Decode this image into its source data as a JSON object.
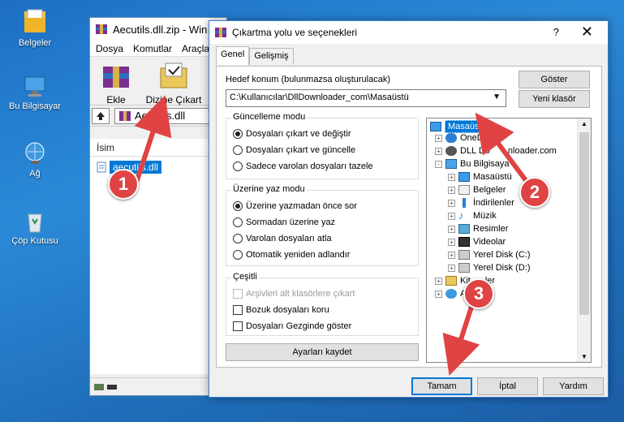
{
  "desktop": {
    "icons": [
      {
        "label": "Belgeler"
      },
      {
        "label": "Bu Bilgisayar"
      },
      {
        "label": "Ağ"
      },
      {
        "label": "Çöp Kutusu"
      }
    ]
  },
  "winrar": {
    "title": "Aecutils.dll.zip - Win",
    "menu": [
      "Dosya",
      "Komutlar",
      "Araçla"
    ],
    "tools": [
      {
        "label": "Ekle"
      },
      {
        "label": "Dizine Çıkart"
      }
    ],
    "address": "Aecutils.dll",
    "column_name": "İsim",
    "file": "aecutils.dll"
  },
  "dialog": {
    "title": "Çıkartma yolu ve seçenekleri",
    "help": "?",
    "close": "✕",
    "tabs": [
      "Genel",
      "Gelişmiş"
    ],
    "dest_label": "Hedef konum (bulunmazsa oluşturulacak)",
    "dest_value": "C:\\Kullanıcılar\\DllDownloader_com\\Masaüstü",
    "show_button": "Göster",
    "new_folder_button": "Yeni klasör",
    "update_group": {
      "title": "Güncelleme modu",
      "options": [
        "Dosyaları çıkart ve değiştir",
        "Dosyaları çıkart ve güncelle",
        "Sadece varolan dosyaları tazele"
      ],
      "selected": 0
    },
    "overwrite_group": {
      "title": "Üzerine yaz modu",
      "options": [
        "Üzerine yazmadan önce sor",
        "Sormadan üzerine yaz",
        "Varolan dosyaları atla",
        "Otomatik yeniden adlandır"
      ],
      "selected": 0
    },
    "misc_group": {
      "title": "Çeşitli",
      "options": [
        "Arşivleri alt klasörlere çıkart",
        "Bozuk dosyaları koru",
        "Dosyaları Gezginde göster"
      ]
    },
    "save_settings": "Ayarları kaydet",
    "tree": [
      "Masaüstü",
      "OneD",
      "DLL Do",
      "nloader.com",
      "Bu Bilgisaya",
      "Masaüstü",
      "Belgeler",
      "İndirilenler",
      "Müzik",
      "Resimler",
      "Videolar",
      "Yerel Disk (C:)",
      "Yerel Disk (D:)",
      "Kit",
      "ler",
      "A"
    ],
    "ok": "Tamam",
    "cancel": "İptal",
    "help_button": "Yardım"
  },
  "badges": [
    "1",
    "2",
    "3"
  ],
  "colors": {
    "selection": "#0078d7",
    "badge": "#e04343"
  }
}
